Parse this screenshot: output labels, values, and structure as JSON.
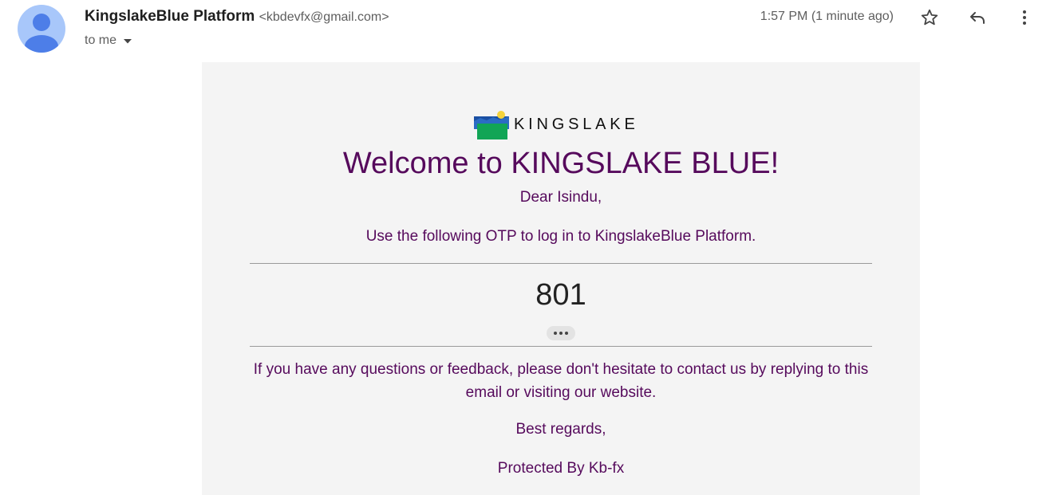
{
  "message_header": {
    "sender_name": "KingslakeBlue Platform",
    "sender_email": "<kbdevfx@gmail.com>",
    "recipient_label": "to me",
    "timestamp": "1:57 PM (1 minute ago)"
  },
  "icons": {
    "avatar": "person-avatar-icon",
    "recipient_toggle": "caret-down-icon",
    "star": "star-outline-icon",
    "reply": "reply-arrow-icon",
    "more": "vertical-dots-icon"
  },
  "email_body": {
    "logo_text": "KINGSLAKE",
    "welcome_heading": "Welcome to KINGSLAKE BLUE!",
    "greeting": "Dear Isindu,",
    "instruction": "Use the following OTP to log in to KingslakeBlue Platform.",
    "otp_code": "801",
    "contact_text": "If you have any questions or feedback, please don't hesitate to contact us by replying to this email or visiting our website.",
    "sign_off": "Best regards,",
    "footer": "Protected By Kb-fx"
  },
  "colors": {
    "accent_text": "#560a5c",
    "card_background": "#f4f4f4",
    "avatar_background": "#a8c7fa",
    "avatar_figure": "#4d7ee8"
  }
}
